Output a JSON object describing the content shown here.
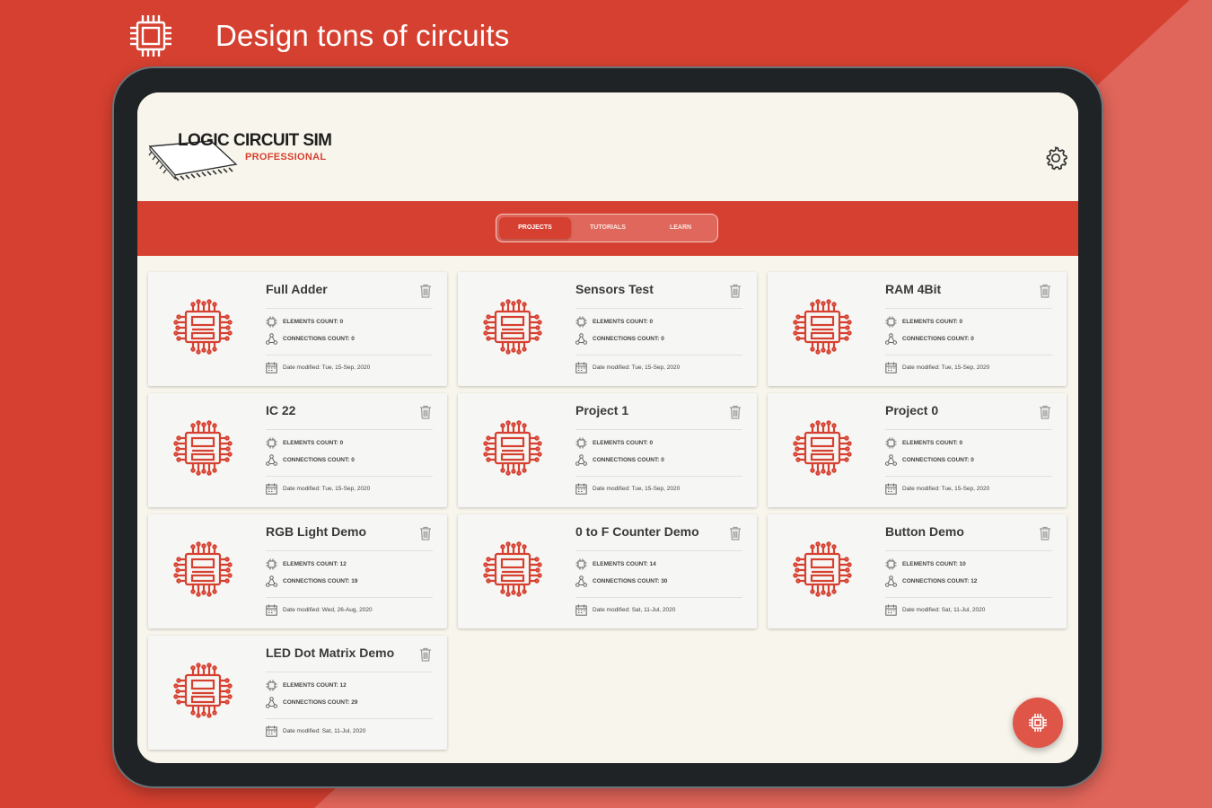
{
  "promo": {
    "tagline": "Design tons of circuits",
    "icon": "cpu-chip-icon"
  },
  "header": {
    "logo_title": "LOGIC CIRCUIT SIM",
    "logo_subtitle": "PROFESSIONAL",
    "settings_icon": "gear-icon"
  },
  "tabs": [
    {
      "label": "PROJECTS",
      "active": true
    },
    {
      "label": "TUTORIALS",
      "active": false
    },
    {
      "label": "LEARN",
      "active": false
    }
  ],
  "projects": [
    {
      "title": "Full Adder",
      "elements": "ELEMENTS COUNT: 0",
      "connections": "CONNECTIONS COUNT: 0",
      "date": "Date modified: Tue, 15-Sep, 2020"
    },
    {
      "title": "Sensors Test",
      "elements": "ELEMENTS COUNT: 0",
      "connections": "CONNECTIONS COUNT: 0",
      "date": "Date modified: Tue, 15-Sep, 2020"
    },
    {
      "title": "RAM 4Bit",
      "elements": "ELEMENTS COUNT: 0",
      "connections": "CONNECTIONS COUNT: 0",
      "date": "Date modified: Tue, 15-Sep, 2020"
    },
    {
      "title": "IC 22",
      "elements": "ELEMENTS COUNT: 0",
      "connections": "CONNECTIONS COUNT: 0",
      "date": "Date modified: Tue, 15-Sep, 2020"
    },
    {
      "title": "Project 1",
      "elements": "ELEMENTS COUNT: 0",
      "connections": "CONNECTIONS COUNT: 0",
      "date": "Date modified: Tue, 15-Sep, 2020"
    },
    {
      "title": "Project 0",
      "elements": "ELEMENTS COUNT: 0",
      "connections": "CONNECTIONS COUNT: 0",
      "date": "Date modified: Tue, 15-Sep, 2020"
    },
    {
      "title": "RGB Light Demo",
      "elements": "ELEMENTS COUNT: 12",
      "connections": "CONNECTIONS COUNT: 19",
      "date": "Date modified: Wed, 26-Aug, 2020"
    },
    {
      "title": "0 to F Counter Demo",
      "elements": "ELEMENTS COUNT: 14",
      "connections": "CONNECTIONS COUNT: 30",
      "date": "Date modified: Sat, 11-Jul, 2020"
    },
    {
      "title": "Button Demo",
      "elements": "ELEMENTS COUNT: 10",
      "connections": "CONNECTIONS COUNT: 12",
      "date": "Date modified: Sat, 11-Jul, 2020"
    },
    {
      "title": "LED Dot Matrix Demo",
      "elements": "ELEMENTS COUNT: 12",
      "connections": "CONNECTIONS COUNT: 29",
      "date": "Date modified: Sat, 11-Jul, 2020"
    }
  ],
  "fab": {
    "icon": "cpu-chip-icon"
  },
  "colors": {
    "accent": "#d64030",
    "background": "#f8f6ec",
    "card": "#f6f6f4"
  }
}
